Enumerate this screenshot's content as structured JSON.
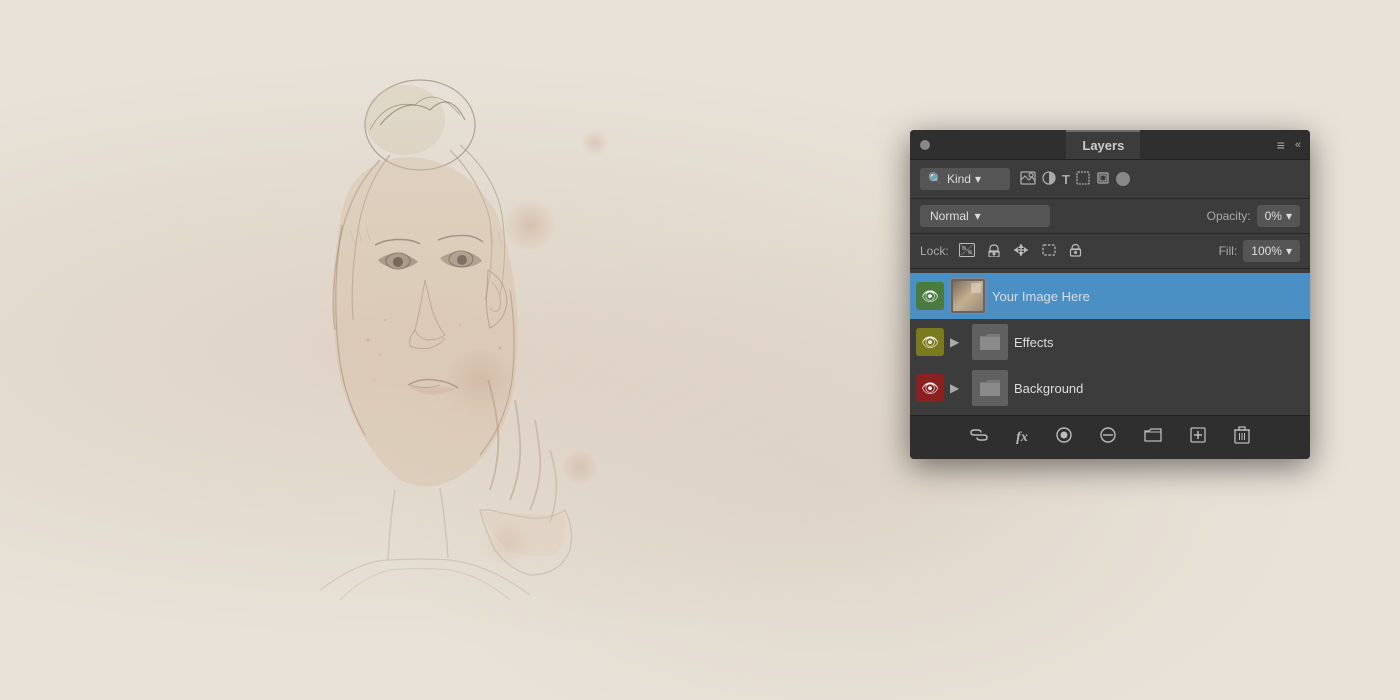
{
  "background": {
    "color": "#e8e2d8"
  },
  "panel": {
    "title": "Layers",
    "close_label": "×",
    "collapse_label": "«",
    "menu_icon": "≡",
    "filter_row": {
      "search_icon": "🔍",
      "kind_label": "Kind",
      "icons": [
        "image-icon",
        "circle-icon",
        "text-icon",
        "crop-icon",
        "layer-icon"
      ],
      "circle_label": "●"
    },
    "blend_row": {
      "blend_mode": "Normal",
      "opacity_label": "Opacity:",
      "opacity_value": "0%"
    },
    "lock_row": {
      "lock_label": "Lock:",
      "lock_icons": [
        "grid-icon",
        "brush-icon",
        "move-icon",
        "transform-icon",
        "padlock-icon"
      ],
      "fill_label": "Fill:",
      "fill_value": "100%"
    },
    "layers": [
      {
        "name": "Your Image Here",
        "eye_color": "green",
        "type": "image",
        "selected": true,
        "has_chevron": false
      },
      {
        "name": "Effects",
        "eye_color": "olive",
        "type": "folder",
        "selected": false,
        "has_chevron": true
      },
      {
        "name": "Background",
        "eye_color": "red",
        "type": "folder",
        "selected": false,
        "has_chevron": true
      }
    ],
    "toolbar": {
      "link_icon": "🔗",
      "fx_label": "fx",
      "circle_icon": "⊙",
      "slash_circle": "⊘",
      "folder_icon": "📁",
      "add_icon": "⊕",
      "delete_icon": "🗑"
    }
  }
}
